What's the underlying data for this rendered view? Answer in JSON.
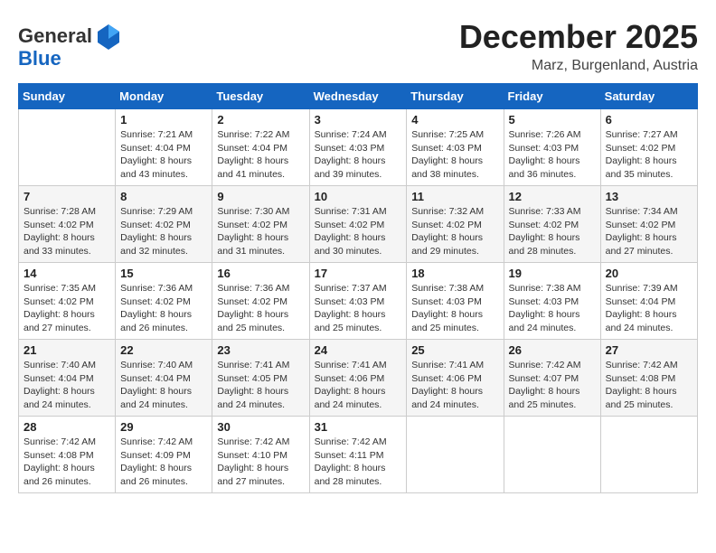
{
  "header": {
    "logo_general": "General",
    "logo_blue": "Blue",
    "month_title": "December 2025",
    "location": "Marz, Burgenland, Austria"
  },
  "days_of_week": [
    "Sunday",
    "Monday",
    "Tuesday",
    "Wednesday",
    "Thursday",
    "Friday",
    "Saturday"
  ],
  "weeks": [
    [
      {
        "day": "",
        "info": ""
      },
      {
        "day": "1",
        "info": "Sunrise: 7:21 AM\nSunset: 4:04 PM\nDaylight: 8 hours\nand 43 minutes."
      },
      {
        "day": "2",
        "info": "Sunrise: 7:22 AM\nSunset: 4:04 PM\nDaylight: 8 hours\nand 41 minutes."
      },
      {
        "day": "3",
        "info": "Sunrise: 7:24 AM\nSunset: 4:03 PM\nDaylight: 8 hours\nand 39 minutes."
      },
      {
        "day": "4",
        "info": "Sunrise: 7:25 AM\nSunset: 4:03 PM\nDaylight: 8 hours\nand 38 minutes."
      },
      {
        "day": "5",
        "info": "Sunrise: 7:26 AM\nSunset: 4:03 PM\nDaylight: 8 hours\nand 36 minutes."
      },
      {
        "day": "6",
        "info": "Sunrise: 7:27 AM\nSunset: 4:02 PM\nDaylight: 8 hours\nand 35 minutes."
      }
    ],
    [
      {
        "day": "7",
        "info": "Sunrise: 7:28 AM\nSunset: 4:02 PM\nDaylight: 8 hours\nand 33 minutes."
      },
      {
        "day": "8",
        "info": "Sunrise: 7:29 AM\nSunset: 4:02 PM\nDaylight: 8 hours\nand 32 minutes."
      },
      {
        "day": "9",
        "info": "Sunrise: 7:30 AM\nSunset: 4:02 PM\nDaylight: 8 hours\nand 31 minutes."
      },
      {
        "day": "10",
        "info": "Sunrise: 7:31 AM\nSunset: 4:02 PM\nDaylight: 8 hours\nand 30 minutes."
      },
      {
        "day": "11",
        "info": "Sunrise: 7:32 AM\nSunset: 4:02 PM\nDaylight: 8 hours\nand 29 minutes."
      },
      {
        "day": "12",
        "info": "Sunrise: 7:33 AM\nSunset: 4:02 PM\nDaylight: 8 hours\nand 28 minutes."
      },
      {
        "day": "13",
        "info": "Sunrise: 7:34 AM\nSunset: 4:02 PM\nDaylight: 8 hours\nand 27 minutes."
      }
    ],
    [
      {
        "day": "14",
        "info": "Sunrise: 7:35 AM\nSunset: 4:02 PM\nDaylight: 8 hours\nand 27 minutes."
      },
      {
        "day": "15",
        "info": "Sunrise: 7:36 AM\nSunset: 4:02 PM\nDaylight: 8 hours\nand 26 minutes."
      },
      {
        "day": "16",
        "info": "Sunrise: 7:36 AM\nSunset: 4:02 PM\nDaylight: 8 hours\nand 25 minutes."
      },
      {
        "day": "17",
        "info": "Sunrise: 7:37 AM\nSunset: 4:03 PM\nDaylight: 8 hours\nand 25 minutes."
      },
      {
        "day": "18",
        "info": "Sunrise: 7:38 AM\nSunset: 4:03 PM\nDaylight: 8 hours\nand 25 minutes."
      },
      {
        "day": "19",
        "info": "Sunrise: 7:38 AM\nSunset: 4:03 PM\nDaylight: 8 hours\nand 24 minutes."
      },
      {
        "day": "20",
        "info": "Sunrise: 7:39 AM\nSunset: 4:04 PM\nDaylight: 8 hours\nand 24 minutes."
      }
    ],
    [
      {
        "day": "21",
        "info": "Sunrise: 7:40 AM\nSunset: 4:04 PM\nDaylight: 8 hours\nand 24 minutes."
      },
      {
        "day": "22",
        "info": "Sunrise: 7:40 AM\nSunset: 4:04 PM\nDaylight: 8 hours\nand 24 minutes."
      },
      {
        "day": "23",
        "info": "Sunrise: 7:41 AM\nSunset: 4:05 PM\nDaylight: 8 hours\nand 24 minutes."
      },
      {
        "day": "24",
        "info": "Sunrise: 7:41 AM\nSunset: 4:06 PM\nDaylight: 8 hours\nand 24 minutes."
      },
      {
        "day": "25",
        "info": "Sunrise: 7:41 AM\nSunset: 4:06 PM\nDaylight: 8 hours\nand 24 minutes."
      },
      {
        "day": "26",
        "info": "Sunrise: 7:42 AM\nSunset: 4:07 PM\nDaylight: 8 hours\nand 25 minutes."
      },
      {
        "day": "27",
        "info": "Sunrise: 7:42 AM\nSunset: 4:08 PM\nDaylight: 8 hours\nand 25 minutes."
      }
    ],
    [
      {
        "day": "28",
        "info": "Sunrise: 7:42 AM\nSunset: 4:08 PM\nDaylight: 8 hours\nand 26 minutes."
      },
      {
        "day": "29",
        "info": "Sunrise: 7:42 AM\nSunset: 4:09 PM\nDaylight: 8 hours\nand 26 minutes."
      },
      {
        "day": "30",
        "info": "Sunrise: 7:42 AM\nSunset: 4:10 PM\nDaylight: 8 hours\nand 27 minutes."
      },
      {
        "day": "31",
        "info": "Sunrise: 7:42 AM\nSunset: 4:11 PM\nDaylight: 8 hours\nand 28 minutes."
      },
      {
        "day": "",
        "info": ""
      },
      {
        "day": "",
        "info": ""
      },
      {
        "day": "",
        "info": ""
      }
    ]
  ]
}
